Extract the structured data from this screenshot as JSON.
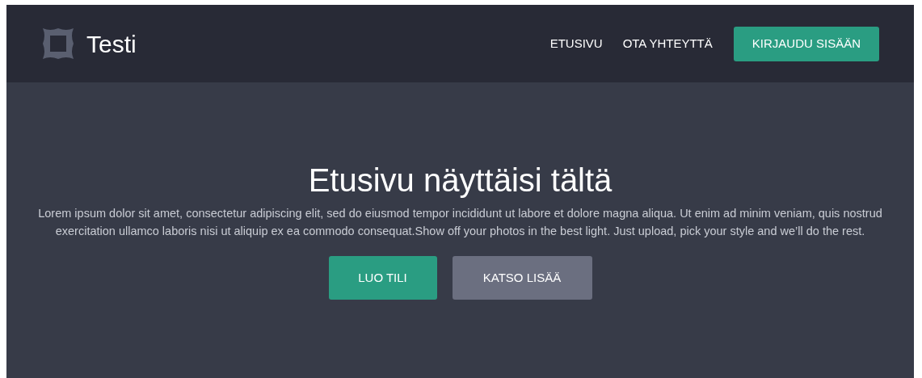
{
  "header": {
    "logo_text": "Testi",
    "nav": [
      {
        "label": "ETUSIVU"
      },
      {
        "label": "OTA YHTEYTTÄ"
      }
    ],
    "login_button": "KIRJAUDU SISÄÄN"
  },
  "hero": {
    "title": "Etusivu näyttäisi tältä",
    "text": "Lorem ipsum dolor sit amet, consectetur adipiscing elit, sed do eiusmod tempor incididunt ut labore et dolore magna aliqua. Ut enim ad minim veniam, quis nostrud exercitation ullamco laboris nisi ut aliquip ex ea commodo consequat.Show off your photos in the best light.  Just upload, pick your style and we’ll do the rest.",
    "buttons": [
      {
        "label": "LUO TILI",
        "kind": "primary"
      },
      {
        "label": "KATSO LISÄÄ",
        "kind": "secondary"
      }
    ]
  }
}
